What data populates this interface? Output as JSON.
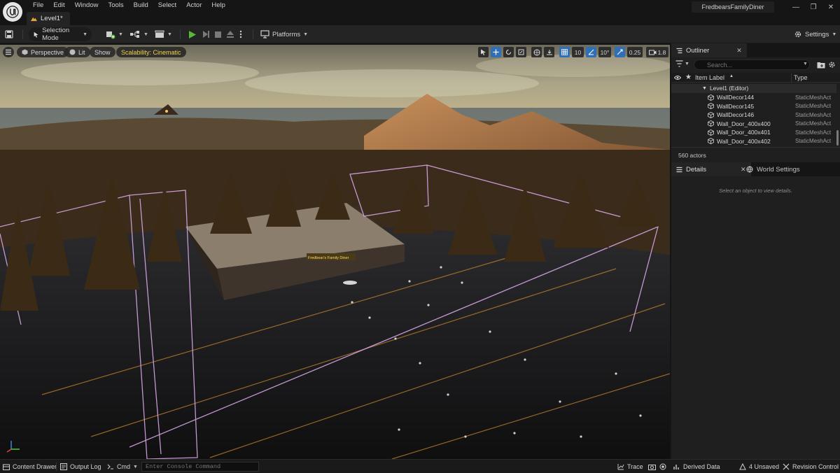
{
  "menu": [
    "File",
    "Edit",
    "Window",
    "Tools",
    "Build",
    "Select",
    "Actor",
    "Help"
  ],
  "level_tab": "Level1*",
  "project_name": "FredbearsFamilyDiner",
  "toolbar": {
    "selection_mode": "Selection Mode",
    "platforms": "Platforms",
    "settings": "Settings"
  },
  "viewport": {
    "perspective": "Perspective",
    "lit": "Lit",
    "show": "Show",
    "scalability": "Scalability: Cinematic",
    "grid_size": "10",
    "rotation_snap": "10°",
    "scale_snap": "0.25",
    "camera_speed": "1.8",
    "sign_text": "Fredbear's Family Diner"
  },
  "outliner": {
    "tab_label": "Outliner",
    "search_placeholder": "Search...",
    "col_label": "Item Label",
    "col_type": "Type",
    "root": "Level1 (Editor)",
    "rows": [
      {
        "label": "WallDecor144",
        "type": "StaticMeshAct"
      },
      {
        "label": "WallDecor145",
        "type": "StaticMeshAct"
      },
      {
        "label": "WallDecor146",
        "type": "StaticMeshAct"
      },
      {
        "label": "Wall_Door_400x400",
        "type": "StaticMeshAct"
      },
      {
        "label": "Wall_Door_400x401",
        "type": "StaticMeshAct"
      },
      {
        "label": "Wall_Door_400x402",
        "type": "StaticMeshAct"
      }
    ],
    "actor_count": "560 actors"
  },
  "details": {
    "tab_label": "Details",
    "world_settings": "World Settings",
    "empty_message": "Select an object to view details."
  },
  "statusbar": {
    "content_drawer": "Content Drawer",
    "output_log": "Output Log",
    "cmd": "Cmd",
    "console_placeholder": "Enter Console Command",
    "trace": "Trace",
    "derived_data": "Derived Data",
    "unsaved": "4 Unsaved",
    "revision_control": "Revision Control"
  },
  "colors": {
    "accent_blue": "#2f6fb8",
    "play_green": "#58b83a",
    "scalability_yellow": "#f2d24a",
    "volume_outline": "#d7a6e6"
  }
}
